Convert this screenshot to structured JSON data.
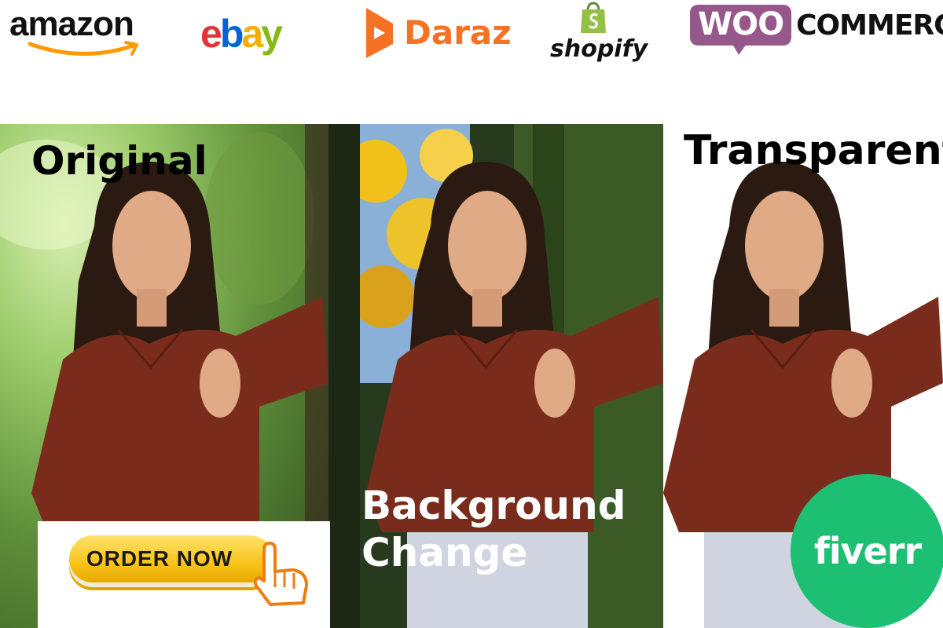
{
  "logos": {
    "amazon": "amazon",
    "ebay": [
      "e",
      "b",
      "a",
      "y"
    ],
    "daraz": "Daraz",
    "shopify": "shopify",
    "woo_bubble": "WOO",
    "woo_word": "COMMERCE"
  },
  "labels": {
    "original": "Original",
    "background_line1": "Background",
    "background_line2": "Change",
    "transparent": "Transparent"
  },
  "order_button": "ORDER NOW",
  "fiverr_badge": "fiverr",
  "colors": {
    "amazon_smile": "#ff9900",
    "ebay_e": "#e53238",
    "ebay_b": "#0064d2",
    "ebay_a": "#f5af02",
    "ebay_y": "#86b817",
    "daraz": "#f57224",
    "shopify_bag": "#95bf47",
    "woo": "#96588a",
    "order_button": "#f9c31a",
    "fiverr": "#1dbf73",
    "top_red": "#7a2c1c"
  },
  "icons": [
    "amazon-smile-icon",
    "daraz-box-icon",
    "shopify-bag-icon",
    "pointing-hand-icon"
  ]
}
